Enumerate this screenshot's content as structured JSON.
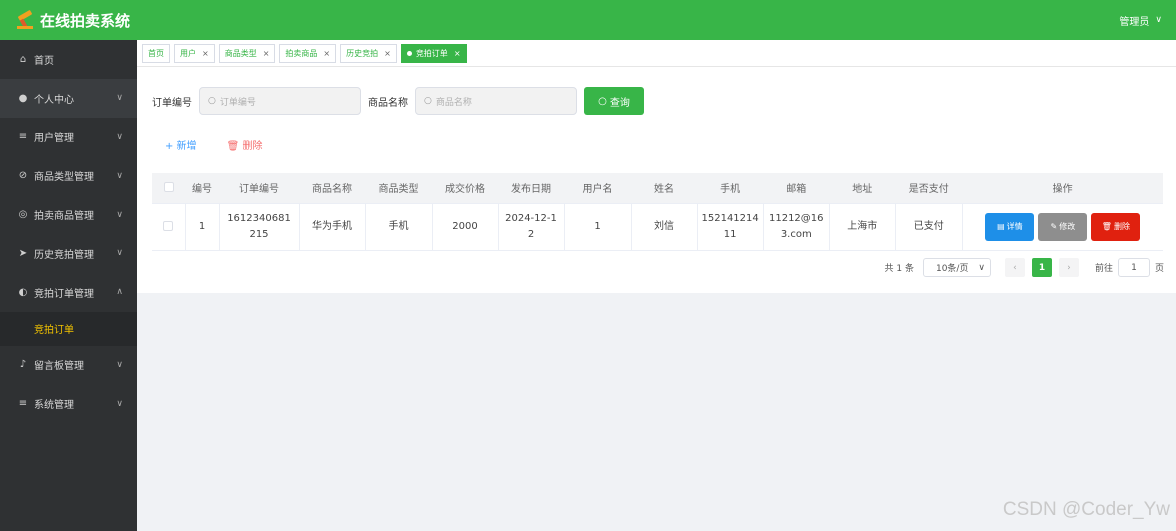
{
  "header": {
    "title": "在线拍卖系统",
    "user": "管理员",
    "user_chevron": "∨"
  },
  "sidebar": {
    "items": [
      {
        "label": "首页",
        "icon": "home-icon",
        "glyph": "⌂",
        "arrow": ""
      },
      {
        "label": "个人中心",
        "icon": "user-icon",
        "glyph": "👤",
        "arrow": "∨"
      },
      {
        "label": "用户管理",
        "icon": "list-icon",
        "glyph": "≡",
        "arrow": "∨"
      },
      {
        "label": "商品类型管理",
        "icon": "tag-icon",
        "glyph": "⊘",
        "arrow": "∨"
      },
      {
        "label": "拍卖商品管理",
        "icon": "goods-icon",
        "glyph": "◎",
        "arrow": "∨"
      },
      {
        "label": "历史竞拍管理",
        "icon": "send-icon",
        "glyph": "➤",
        "arrow": "∨"
      },
      {
        "label": "竞拍订单管理",
        "icon": "compass-icon",
        "glyph": "◐",
        "arrow": "∧"
      },
      {
        "label": "留言板管理",
        "icon": "mic-icon",
        "glyph": "♪",
        "arrow": "∨"
      },
      {
        "label": "系统管理",
        "icon": "menu-icon",
        "glyph": "≡",
        "arrow": "∨"
      }
    ],
    "sub_item": "竞拍订单"
  },
  "tabs": [
    {
      "label": "首页",
      "closable": ""
    },
    {
      "label": "用户",
      "closable": "×"
    },
    {
      "label": "商品类型",
      "closable": "×"
    },
    {
      "label": "拍卖商品",
      "closable": "×"
    },
    {
      "label": "历史竞拍",
      "closable": "×"
    },
    {
      "label": "竞拍订单",
      "closable": "×"
    }
  ],
  "search": {
    "order_label": "订单编号",
    "order_placeholder": "订单编号",
    "name_label": "商品名称",
    "name_placeholder": "商品名称",
    "query_label": "查询"
  },
  "actions": {
    "add": "+ 新增",
    "delete": "删除"
  },
  "table": {
    "headers": [
      "编号",
      "订单编号",
      "商品名称",
      "商品类型",
      "成交价格",
      "发布日期",
      "用户名",
      "姓名",
      "手机",
      "邮箱",
      "地址",
      "是否支付",
      "操作"
    ],
    "rows": [
      {
        "id": "1",
        "order_no_1": "1612340681",
        "order_no_2": "215",
        "name": "华为手机",
        "type": "手机",
        "price": "2000",
        "date_1": "2024-12-1",
        "date_2": "2",
        "username": "1",
        "realname": "刘信",
        "phone_1": "152141214",
        "phone_2": "11",
        "email_1": "11212@16",
        "email_2": "3.com",
        "address": "上海市",
        "paid": "已支付",
        "btn_detail": "详情",
        "btn_edit": "修改",
        "btn_delete": "删除"
      }
    ]
  },
  "pager": {
    "total": "共 1 条",
    "size": "10条/页",
    "page": "1",
    "goto": "前往",
    "goto_value": "1",
    "unit": "页"
  },
  "watermark": "CSDN @Coder_Yw"
}
